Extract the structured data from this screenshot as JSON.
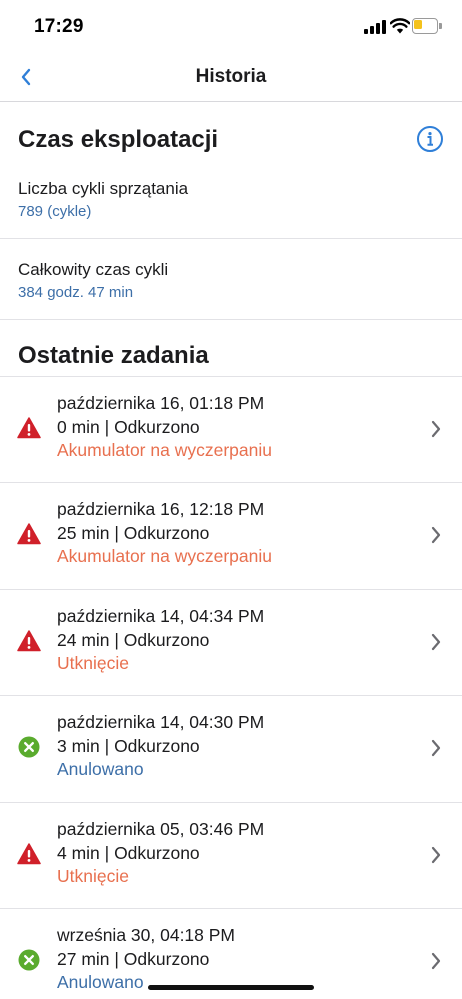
{
  "status_bar": {
    "time": "17:29"
  },
  "nav": {
    "title": "Historia",
    "back_icon": "chevron-left-icon"
  },
  "usage": {
    "title": "Czas eksploatacji",
    "info_icon": "info-icon",
    "cycles_label": "Liczba cykli sprzątania",
    "cycles_value": "789 (cykle)",
    "time_label": "Całkowity czas cykli",
    "time_value": "384 godz. 47 min"
  },
  "recent": {
    "title": "Ostatnie zadania",
    "tasks": [
      {
        "date": "października 16, 01:18 PM",
        "summary": "0 min | Odkurzono",
        "status": "Akumulator na wyczerpaniu",
        "kind": "warning"
      },
      {
        "date": "października 16, 12:18 PM",
        "summary": "25 min | Odkurzono",
        "status": "Akumulator na wyczerpaniu",
        "kind": "warning"
      },
      {
        "date": "października 14, 04:34 PM",
        "summary": "24 min | Odkurzono",
        "status": "Utknięcie",
        "kind": "warning"
      },
      {
        "date": "października 14, 04:30 PM",
        "summary": "3 min | Odkurzono",
        "status": "Anulowano",
        "kind": "cancelled"
      },
      {
        "date": "października 05, 03:46 PM",
        "summary": "4 min | Odkurzono",
        "status": "Utknięcie",
        "kind": "warning"
      },
      {
        "date": "września 30, 04:18 PM",
        "summary": "27 min | Odkurzono",
        "status": "Anulowano",
        "kind": "cancelled"
      }
    ]
  },
  "colors": {
    "accent_blue": "#3d6fa8",
    "ios_blue": "#2f7fd8",
    "warning_red": "#d0202a",
    "status_orange": "#e8704f",
    "cancel_green": "#5aab2e",
    "battery_yellow": "#f4c21c"
  }
}
